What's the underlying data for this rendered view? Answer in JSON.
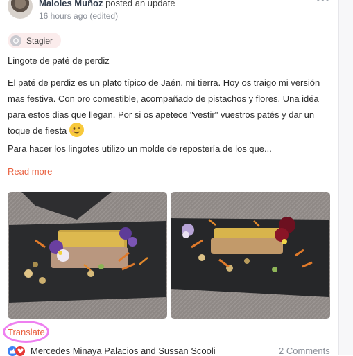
{
  "post": {
    "author": "Maloles Muñoz",
    "action": "posted an update",
    "timestamp": "16 hours ago (edited)",
    "more_icon": "ellipsis-icon",
    "badge": {
      "label": "Stagier",
      "icon": "badge-icon"
    },
    "title": "Lingote de paté de perdiz",
    "body": "El paté de perdiz es un plato típico de Jaén, mi tierra. Hoy os traigo mi versión mas festiva. Con oro comestible, acompañado de pistachos y flores. Una idéa para estos dias que llegan. Por si os apetece \"vestir\" vuestros patés y dar un toque de fiesta",
    "emoji": "winking-face-emoji",
    "excerpt": "Para hacer los lingotes utilizo un molde de repostería de los que...",
    "read_more": "Read more",
    "translate": "Translate",
    "reactions": {
      "icons": [
        "like-icon",
        "heart-icon"
      ],
      "names": "Mercedes Minaya Palacios and Sussan Scooli"
    },
    "comments": "2 Comments"
  },
  "colors": {
    "accent": "#e9603f",
    "highlight_ring": "#ee7ff0",
    "author": "#2f3a4a",
    "badge_bg": "#fbecec"
  }
}
